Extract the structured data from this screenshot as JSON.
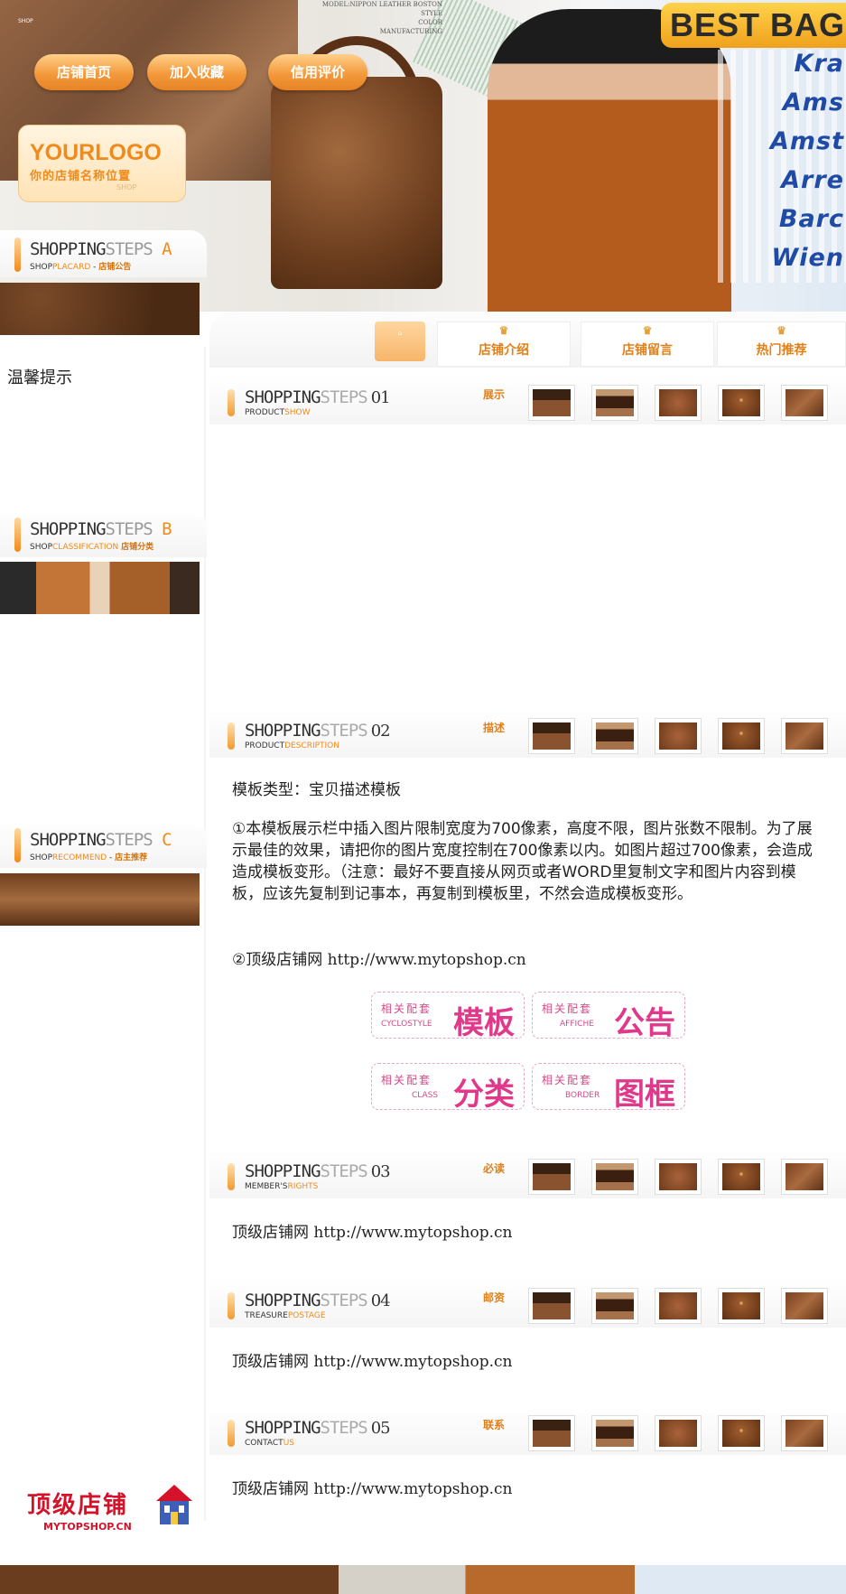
{
  "banner": {
    "best_bag": "BEST BAG",
    "specs": [
      "MODEL:NIPPON LEATHER BOSTON",
      "STYLE",
      "COLOR",
      "MANUFACTURING"
    ],
    "cities": [
      "Kra",
      "Ams",
      "Amst",
      "Arre",
      "Barc",
      "Wien"
    ],
    "tiny_text": "SHOP"
  },
  "nav": {
    "home": "店铺首页",
    "favorite": "加入收藏",
    "rating": "信用评价"
  },
  "logo": {
    "title": "YOURLOGO",
    "subtitle": "你的店铺名称位置",
    "small": "SHOP"
  },
  "tabs": {
    "intro": "店铺介绍",
    "message": "店铺留言",
    "hot": "热门推荐"
  },
  "sidebar": {
    "a": {
      "title1": "SHOPPING",
      "title2": "STEPS",
      "letter": "A",
      "sub1": "SHOP",
      "sub2": "PLACARD",
      "sub3": "店铺公告"
    },
    "b": {
      "title1": "SHOPPING",
      "title2": "STEPS",
      "letter": "B",
      "sub1": "SHOP",
      "sub2": "CLASSIFICATION",
      "sub3": "店铺分类"
    },
    "c": {
      "title1": "SHOPPING",
      "title2": "STEPS",
      "letter": "C",
      "sub1": "SHOP",
      "sub2": "RECOMMEND",
      "sub3": "店主推荐"
    },
    "tip": "温馨提示"
  },
  "sections": [
    {
      "title1": "SHOPPING",
      "title2": "STEPS",
      "num": "01",
      "sub1": "PRODUCT",
      "sub2": "SHOW",
      "label": "展示"
    },
    {
      "title1": "SHOPPING",
      "title2": "STEPS",
      "num": "02",
      "sub1": "PRODUCT",
      "sub2": "DESCRIPTION",
      "label": "描述"
    },
    {
      "title1": "SHOPPING",
      "title2": "STEPS",
      "num": "03",
      "sub1": "MEMBER'S",
      "sub2": "RIGHTS",
      "label": "必读"
    },
    {
      "title1": "SHOPPING",
      "title2": "STEPS",
      "num": "04",
      "sub1": "TREASURE",
      "sub2": "POSTAGE",
      "label": "邮资"
    },
    {
      "title1": "SHOPPING",
      "title2": "STEPS",
      "num": "05",
      "sub1": "CONTACT",
      "sub2": "US",
      "label": "联系"
    }
  ],
  "description": {
    "type": "模板类型：宝贝描述模板",
    "para1": "①本模板展示栏中插入图片限制宽度为700像素，高度不限，图片张数不限制。为了展示最佳的效果，请把你的图片宽度控制在700像素以内。如图片超过700像素，会造成造成模板变形。（注意：最好不要直接从网页或者WORD里复制文字和图片内容到模板，应该先复制到记事本，再复制到模板里，不然会造成模板变形。",
    "para2_label": "②顶级店铺网",
    "para2_url": "http://www.mytopshop.cn"
  },
  "related": [
    {
      "top": "相关配套",
      "en": "CYCLOSTYLE",
      "big": "模板"
    },
    {
      "top": "相关配套",
      "en": "AFFICHE",
      "big": "公告"
    },
    {
      "top": "相关配套",
      "en": "CLASS",
      "big": "分类"
    },
    {
      "top": "相关配套",
      "en": "BORDER",
      "big": "图框"
    }
  ],
  "shop_line": {
    "label": "顶级店铺网",
    "url": "http://www.mytopshop.cn"
  },
  "footer_logo": {
    "cn": "顶级店铺",
    "en": "MYTOPSHOP.CN"
  }
}
